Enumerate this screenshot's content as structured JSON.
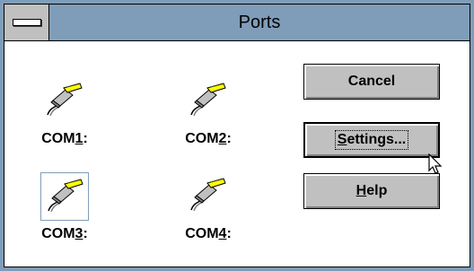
{
  "window": {
    "title": "Ports",
    "title_color": "#7f9db9",
    "face_color": "#c0c0c0"
  },
  "ports": [
    {
      "label": "COM1:",
      "prefix": "COM",
      "mnemonic": "1",
      "suffix": ":",
      "icon": "serial-cable-icon",
      "selected": false
    },
    {
      "label": "COM2:",
      "prefix": "COM",
      "mnemonic": "2",
      "suffix": ":",
      "icon": "serial-cable-icon",
      "selected": false
    },
    {
      "label": "COM3:",
      "prefix": "COM",
      "mnemonic": "3",
      "suffix": ":",
      "icon": "serial-cable-icon",
      "selected": true
    },
    {
      "label": "COM4:",
      "prefix": "COM",
      "mnemonic": "4",
      "suffix": ":",
      "icon": "serial-cable-icon",
      "selected": false
    }
  ],
  "buttons": {
    "cancel": {
      "label": "Cancel"
    },
    "settings": {
      "label": "Settings...",
      "mnemonic": "S",
      "rest": "ettings..."
    },
    "help": {
      "label": "Help",
      "mnemonic": "H",
      "rest": "elp"
    }
  },
  "cursor": {
    "icon": "arrow-cursor-icon"
  }
}
